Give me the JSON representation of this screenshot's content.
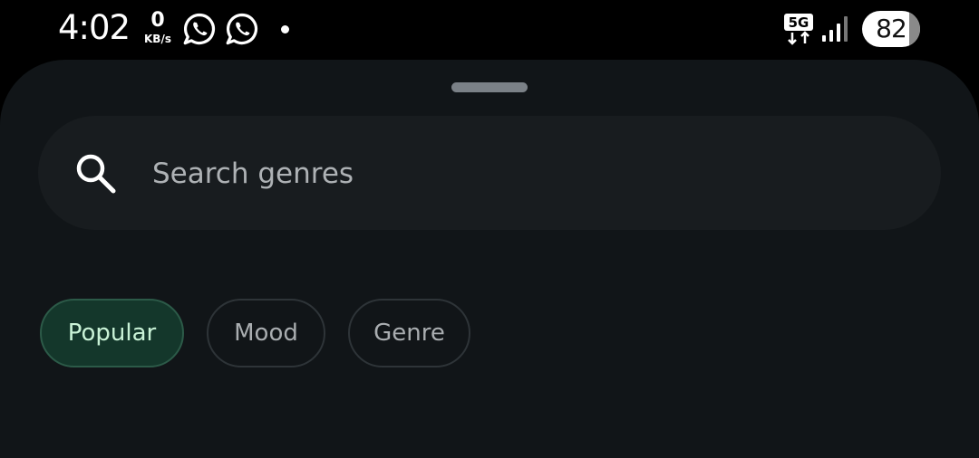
{
  "status_bar": {
    "time": "4:02",
    "net_speed_value": "0",
    "net_speed_unit": "KB/s",
    "notification_icons": [
      "whatsapp-icon",
      "whatsapp-icon"
    ],
    "network_type": "5G",
    "battery_percent": "82"
  },
  "sheet": {
    "search": {
      "placeholder": "Search genres",
      "icon": "search-icon"
    },
    "chips": [
      {
        "label": "Popular",
        "selected": true
      },
      {
        "label": "Mood",
        "selected": false
      },
      {
        "label": "Genre",
        "selected": false
      }
    ]
  },
  "colors": {
    "background": "#000000",
    "sheet": "#111518",
    "search_field": "#181c1f",
    "chip_selected_bg": "#14372b",
    "chip_selected_text": "#c9f2d6",
    "chip_text": "#a9adb0"
  }
}
